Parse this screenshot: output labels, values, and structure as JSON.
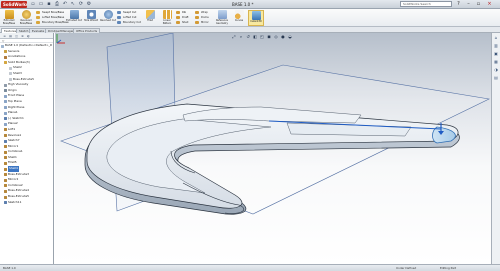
{
  "titlebar": {
    "logo": "SolidWorks",
    "document_title": "BASE 1.0 *",
    "search_placeholder": "SolidWorks Search"
  },
  "commands": {
    "extruded_boss": "Extruded Boss/Base",
    "revolved_boss": "Revolved Boss/Base",
    "swept_boss": "Swept Boss/Base",
    "lofted_boss": "Lofted Boss/Base",
    "boundary_boss": "Boundary Boss/Base",
    "extruded_cut": "Extruded Cut",
    "hole_wizard": "Hole Wizard",
    "revolved_cut": "Revolved Cut",
    "swept_cut": "Swept Cut",
    "lofted_cut": "Lofted Cut",
    "boundary_cut": "Boundary Cut",
    "fillet": "Fillet",
    "linear_pattern": "Linear Pattern",
    "rib": "Rib",
    "draft": "Draft",
    "shell": "Shell",
    "wrap": "Wrap",
    "dome": "Dome",
    "mirror": "Mirror",
    "reference_geometry": "Reference Geometry",
    "curves": "Curves",
    "instant3d": "Instant3D"
  },
  "tabs": [
    "Features",
    "Sketch",
    "Evaluate",
    "DimXpertManager",
    "Office Products"
  ],
  "feature_manager": {
    "root": "BASE 1.0 (Default<<Default>_D",
    "items": [
      {
        "label": "Sensors",
        "level": 1,
        "color": "#c9a040"
      },
      {
        "label": "Annotations",
        "level": 1,
        "color": "#b07a3a"
      },
      {
        "label": "Solid Bodies(3)",
        "level": 1,
        "color": "#d4a640"
      },
      {
        "label": "Shell2",
        "level": 2,
        "color": "#c2c8d0"
      },
      {
        "label": "Shell3",
        "level": 2,
        "color": "#c2c8d0"
      },
      {
        "label": "Boss-Extrude5",
        "level": 2,
        "color": "#c2c8d0"
      },
      {
        "label": "High Viscosity",
        "level": 1,
        "color": "#8e9aa8"
      },
      {
        "label": "Origin",
        "level": 1,
        "color": "#7a8b9c"
      },
      {
        "label": "Front Plane",
        "level": 1,
        "color": "#8aa4c6"
      },
      {
        "label": "Top Plane",
        "level": 1,
        "color": "#8aa4c6"
      },
      {
        "label": "Right Plane",
        "level": 1,
        "color": "#8aa4c6"
      },
      {
        "label": "Plane1",
        "level": 1,
        "color": "#8aa4c6"
      },
      {
        "label": "(-) Sketch1",
        "level": 1,
        "color": "#5d7fae"
      },
      {
        "label": "Plane2",
        "level": 1,
        "color": "#8aa4c6"
      },
      {
        "label": "Loft1",
        "level": 1,
        "color": "#b5873a"
      },
      {
        "label": "Revolve1",
        "level": 1,
        "color": "#b5873a"
      },
      {
        "label": "Sketch7",
        "level": 1,
        "color": "#5d7fae"
      },
      {
        "label": "Mirror1",
        "level": 1,
        "color": "#b5873a"
      },
      {
        "label": "Combine1",
        "level": 1,
        "color": "#b5873a"
      },
      {
        "label": "Shell1",
        "level": 1,
        "color": "#b5873a"
      },
      {
        "label": "Fillet5",
        "level": 1,
        "color": "#b5873a"
      },
      {
        "label": "Shell4",
        "level": 1,
        "color": "#b5873a",
        "selected": true
      },
      {
        "label": "Boss-Extrude3",
        "level": 1,
        "color": "#b5873a"
      },
      {
        "label": "Mirror2",
        "level": 1,
        "color": "#b5873a"
      },
      {
        "label": "Combine2",
        "level": 1,
        "color": "#b5873a"
      },
      {
        "label": "Boss-Extrude4",
        "level": 1,
        "color": "#b5873a"
      },
      {
        "label": "Boss-Extrude5",
        "level": 1,
        "color": "#b5873a"
      },
      {
        "label": "Sketch11",
        "level": 1,
        "color": "#5d7fae"
      }
    ]
  },
  "statusbar": {
    "left": "BASE 1.0",
    "right_a": "Under Defined",
    "right_b": "Editing Part"
  },
  "colors": {
    "accent": "#3c76c4",
    "logo_red": "#c0281e",
    "part_face": "#e3e9f0",
    "selected_face": "#b8d6ee"
  },
  "icons": {
    "new": "new-icon",
    "open": "open-icon",
    "save": "save-icon",
    "print": "print-icon",
    "undo": "undo-icon",
    "rebuild": "rebuild-icon",
    "options": "options-icon",
    "help": "help-icon"
  }
}
